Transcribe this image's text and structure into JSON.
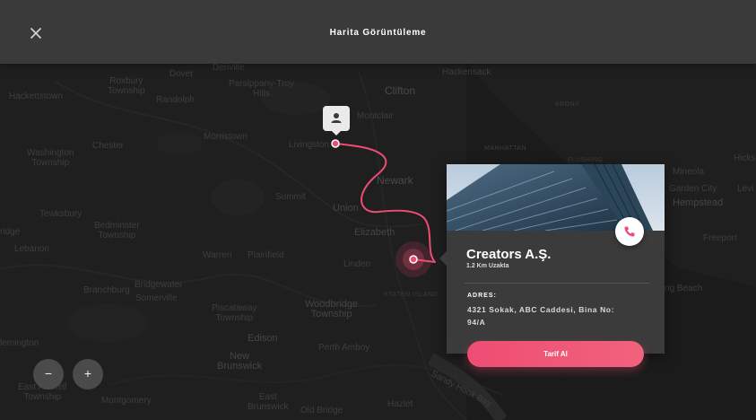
{
  "header": {
    "title": "Harita Görüntüleme"
  },
  "map": {
    "places": [
      {
        "id": "dover",
        "name": "Dover"
      },
      {
        "id": "denville",
        "name": "Denville"
      },
      {
        "id": "roxbury",
        "name": "Roxbury\nTownship"
      },
      {
        "id": "parsippany",
        "name": "Parsippany-Troy\nHills"
      },
      {
        "id": "hackensack",
        "name": "Hackensack"
      },
      {
        "id": "hackettstown",
        "name": "Hackettstown"
      },
      {
        "id": "randolph",
        "name": "Randolph"
      },
      {
        "id": "clifton",
        "name": "Clifton"
      },
      {
        "id": "montclair",
        "name": "Montclair"
      },
      {
        "id": "bronx",
        "name": "BRONX"
      },
      {
        "id": "morristown",
        "name": "Morristown"
      },
      {
        "id": "chester",
        "name": "Chester"
      },
      {
        "id": "livingston",
        "name": "Livingston"
      },
      {
        "id": "manhattan",
        "name": "MANHATTAN"
      },
      {
        "id": "washington",
        "name": "Washington\nTownship"
      },
      {
        "id": "flushing",
        "name": "FLUSHING"
      },
      {
        "id": "hicks",
        "name": "Hicks"
      },
      {
        "id": "mineola",
        "name": "Mineola"
      },
      {
        "id": "newark",
        "name": "Newark"
      },
      {
        "id": "garden-city",
        "name": "Garden City"
      },
      {
        "id": "levi",
        "name": "Levi"
      },
      {
        "id": "summit",
        "name": "Summit"
      },
      {
        "id": "hempstead",
        "name": "Hempstead"
      },
      {
        "id": "union",
        "name": "Union"
      },
      {
        "id": "tewksbury",
        "name": "Tewksbury"
      },
      {
        "id": "bedminster",
        "name": "Bedminster\nTownship"
      },
      {
        "id": "elizabeth",
        "name": "Elizabeth"
      },
      {
        "id": "bridge",
        "name": "ridge"
      },
      {
        "id": "freeport",
        "name": "Freeport"
      },
      {
        "id": "lebanon",
        "name": "Lebanon"
      },
      {
        "id": "warren",
        "name": "Warren"
      },
      {
        "id": "plainfield",
        "name": "Plainfield"
      },
      {
        "id": "linden",
        "name": "Linden"
      },
      {
        "id": "branchburg",
        "name": "Branchburg"
      },
      {
        "id": "bridgewater",
        "name": "Bridgewater"
      },
      {
        "id": "somerville",
        "name": "Somerville"
      },
      {
        "id": "staten-island",
        "name": "STATEN ISLAND"
      },
      {
        "id": "long-beach",
        "name": "ng Beach"
      },
      {
        "id": "piscataway",
        "name": "Piscataway\nTownship"
      },
      {
        "id": "woodbridge",
        "name": "Woodbridge\nTownship"
      },
      {
        "id": "edison",
        "name": "Edison"
      },
      {
        "id": "flemington",
        "name": "lemington"
      },
      {
        "id": "perth-amboy",
        "name": "Perth Amboy"
      },
      {
        "id": "new-brunswick",
        "name": "New\nBrunswick"
      },
      {
        "id": "east-amwell",
        "name": "East Amwell\nTownship"
      },
      {
        "id": "montgomery",
        "name": "Montgomery"
      },
      {
        "id": "east-brunswick",
        "name": "East\nBrunswick"
      },
      {
        "id": "old-bridge",
        "name": "Old Bridge"
      },
      {
        "id": "hazlet",
        "name": "Hazlet"
      },
      {
        "id": "sandy-hook",
        "name": "Sandy Hook Bay"
      }
    ]
  },
  "card": {
    "name": "Creators A.Ş.",
    "distance": "1.2 Km Uzakta",
    "address_label": "ADRES:",
    "address": "4321 Sokak, ABC Caddesi, Bina No: 94/A",
    "directions_label": "Tarif Al"
  },
  "zoom": {
    "out_label": "−",
    "in_label": "+"
  },
  "colors": {
    "accent": "#ee4d73",
    "header_bg": "#3a3a3a",
    "card_bg": "#3b3b3b",
    "map_bg": "#1f1f1f"
  },
  "icons": {
    "close": "close-icon",
    "user": "user-icon",
    "phone": "phone-icon"
  }
}
